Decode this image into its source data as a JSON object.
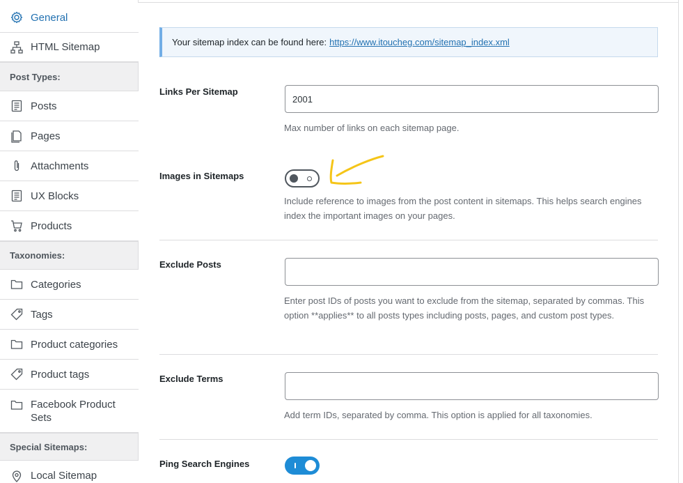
{
  "sidebar": {
    "general": "General",
    "html_sitemap": "HTML Sitemap",
    "post_types_heading": "Post Types:",
    "posts": "Posts",
    "pages": "Pages",
    "attachments": "Attachments",
    "ux_blocks": "UX Blocks",
    "products": "Products",
    "taxonomies_heading": "Taxonomies:",
    "categories": "Categories",
    "tags": "Tags",
    "product_categories": "Product categories",
    "product_tags": "Product tags",
    "facebook_product_sets": "Facebook Product Sets",
    "special_heading": "Special Sitemaps:",
    "local_sitemap": "Local Sitemap"
  },
  "notice": {
    "text": "Your sitemap index can be found here:",
    "link": "https://www.itoucheg.com/sitemap_index.xml"
  },
  "settings": {
    "links_per_sitemap": {
      "label": "Links Per Sitemap",
      "value": "2001",
      "description": "Max number of links on each sitemap page."
    },
    "images_in_sitemaps": {
      "label": "Images in Sitemaps",
      "enabled": false,
      "description": "Include reference to images from the post content in sitemaps. This helps search engines index the important images on your pages."
    },
    "exclude_posts": {
      "label": "Exclude Posts",
      "value": "",
      "description": "Enter post IDs of posts you want to exclude from the sitemap, separated by commas. This option **applies** to all posts types including posts, pages, and custom post types."
    },
    "exclude_terms": {
      "label": "Exclude Terms",
      "value": "",
      "description": "Add term IDs, separated by comma. This option is applied for all taxonomies."
    },
    "ping_search_engines": {
      "label": "Ping Search Engines",
      "enabled": true
    }
  },
  "colors": {
    "accent": "#2271b1",
    "toggle_on": "#1e8cd6",
    "annotation": "#f5c518"
  }
}
